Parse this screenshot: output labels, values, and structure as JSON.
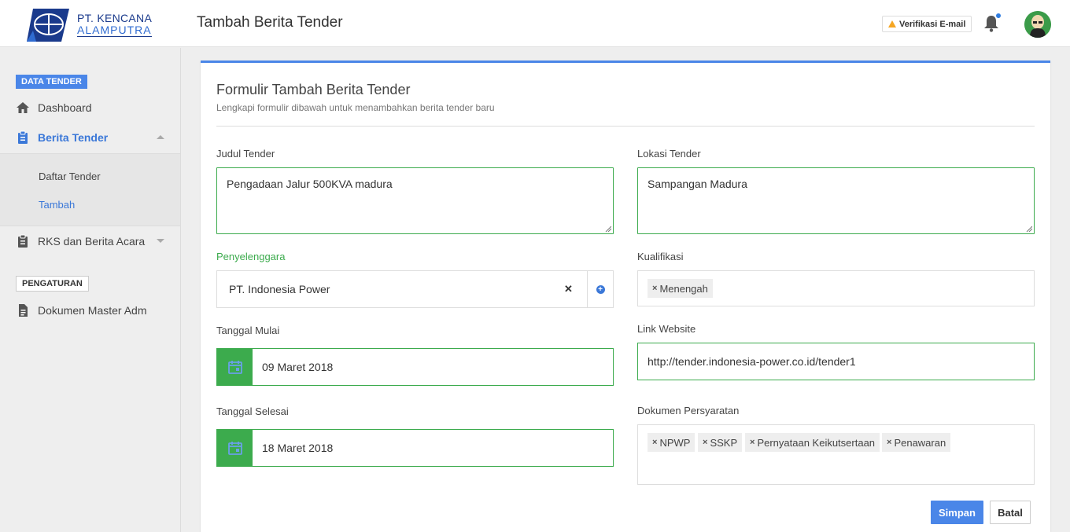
{
  "brand": {
    "line1": "PT. KENCANA",
    "line2": "ALAMPUTRA"
  },
  "header": {
    "title": "Tambah Berita Tender",
    "verify_label": "Verifikasi E-mail"
  },
  "sidebar": {
    "section_data": "DATA TENDER",
    "section_settings": "PENGATURAN",
    "items": {
      "dashboard": "Dashboard",
      "berita_tender": "Berita Tender",
      "daftar_tender": "Daftar Tender",
      "tambah": "Tambah",
      "rks": "RKS dan Berita Acara",
      "dokumen_master": "Dokumen Master Adm"
    }
  },
  "form": {
    "title": "Formulir Tambah Berita Tender",
    "subtitle": "Lengkapi formulir dibawah untuk menambahkan berita tender baru",
    "judul": {
      "label": "Judul Tender",
      "value": "Pengadaan Jalur 500KVA madura"
    },
    "lokasi": {
      "label": "Lokasi Tender",
      "value": "Sampangan Madura"
    },
    "penyelenggara": {
      "label": "Penyelenggara",
      "value": "PT. Indonesia Power"
    },
    "kualifikasi": {
      "label": "Kualifikasi",
      "tags": [
        "Menengah"
      ]
    },
    "tanggal_mulai": {
      "label": "Tanggal Mulai",
      "value": "09 Maret 2018"
    },
    "tanggal_selesai": {
      "label": "Tanggal Selesai",
      "value": "18 Maret 2018"
    },
    "link": {
      "label": "Link Website",
      "value": "http://tender.indonesia-power.co.id/tender1"
    },
    "dokumen": {
      "label": "Dokumen Persyaratan",
      "tags": [
        "NPWP",
        "SSKP",
        "Pernyataan Keikutsertaan",
        "Penawaran"
      ]
    },
    "save_label": "Simpan",
    "cancel_label": "Batal"
  },
  "colors": {
    "primary": "#4a86e8",
    "success": "#3cab4d",
    "warning": "#f5a623"
  }
}
